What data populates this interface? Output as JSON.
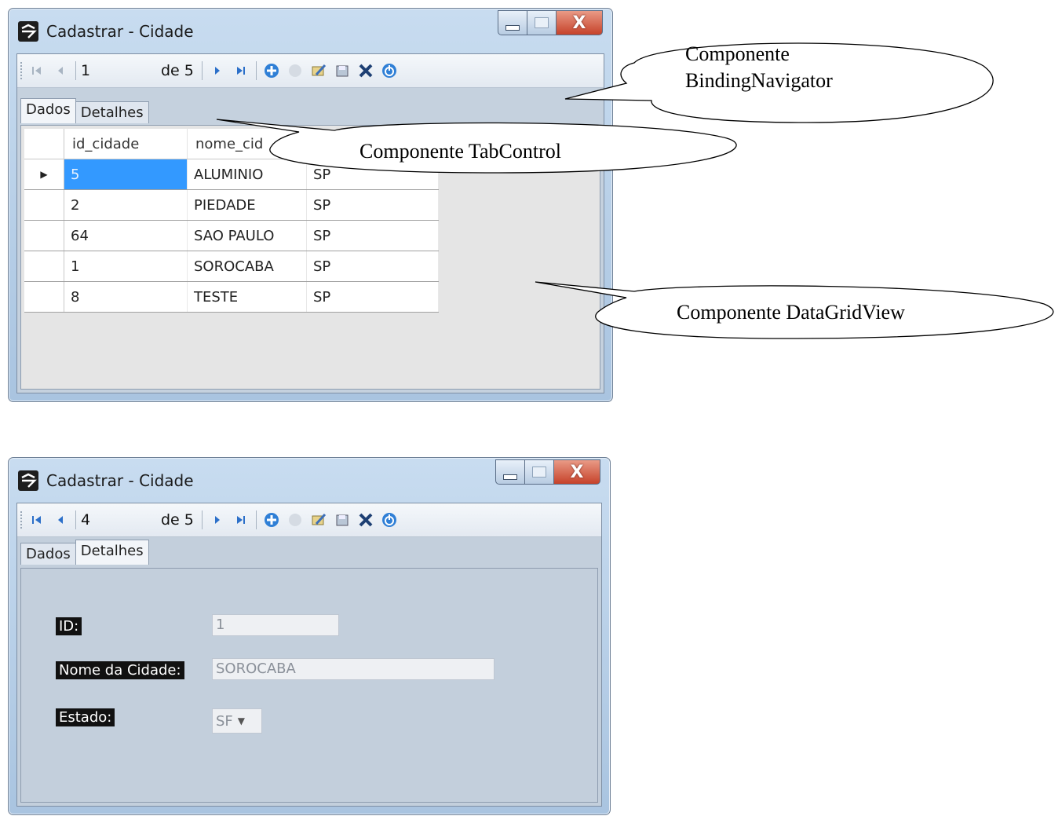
{
  "window1": {
    "title": "Cadastrar - Cidade",
    "close_glyph": "X",
    "navigator": {
      "position": "1",
      "count": "de 5"
    },
    "tabs": [
      {
        "label": "Dados"
      },
      {
        "label": "Detalhes"
      }
    ],
    "grid": {
      "columns": [
        "id_cidade",
        "nome_cid",
        ""
      ],
      "rows": [
        {
          "id": "5",
          "nome": "ALUMINIO",
          "uf": "SP"
        },
        {
          "id": "2",
          "nome": "PIEDADE",
          "uf": "SP"
        },
        {
          "id": "64",
          "nome": "SAO PAULO",
          "uf": "SP"
        },
        {
          "id": "1",
          "nome": "SOROCABA",
          "uf": "SP"
        },
        {
          "id": "8",
          "nome": "TESTE",
          "uf": "SP"
        }
      ]
    }
  },
  "window2": {
    "title": "Cadastrar - Cidade",
    "close_glyph": "X",
    "navigator": {
      "position": "4",
      "count": "de 5"
    },
    "tabs": [
      {
        "label": "Dados"
      },
      {
        "label": "Detalhes"
      }
    ],
    "details": {
      "id_label": "ID:",
      "id_value": "1",
      "nome_label": "Nome da Cidade:",
      "nome_value": "SOROCABA",
      "estado_label": "Estado:",
      "estado_value": "SF"
    }
  },
  "callouts": {
    "binding_navigator_line1": "Componente",
    "binding_navigator_line2": "BindingNavigator",
    "tab_control": "Componente TabControl",
    "data_grid_view": "Componente DataGridView"
  },
  "icons": [
    "move-first-icon",
    "move-previous-icon",
    "move-next-icon",
    "move-last-icon",
    "add-new-icon",
    "delete-icon",
    "edit-icon",
    "save-icon",
    "cancel-icon",
    "power-icon"
  ],
  "colors": {
    "selection": "#3399ff",
    "close_button": "#c6422a",
    "window_frame": "#a9c4e0"
  }
}
